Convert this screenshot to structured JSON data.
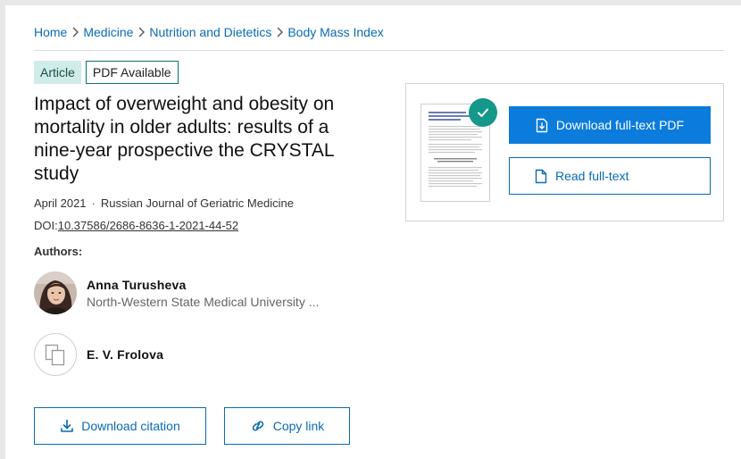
{
  "breadcrumb": {
    "items": [
      "Home",
      "Medicine",
      "Nutrition and Dietetics",
      "Body Mass Index"
    ]
  },
  "badges": {
    "type": "Article",
    "availability": "PDF Available"
  },
  "article": {
    "title": "Impact of overweight and obesity on mortality in older adults: results of a nine-year prospective the CRYSTAL study",
    "date": "April 2021",
    "separator": "·",
    "journal": "Russian Journal of Geriatric Medicine",
    "doi_prefix": "DOI:",
    "doi": "10.37586/2686-8636-1-2021-44-52"
  },
  "authors": {
    "label": "Authors:",
    "list": [
      {
        "name": "Anna Turusheva",
        "affiliation": "North-Western State Medical University ...",
        "avatar": "photo"
      },
      {
        "name": "E. V. Frolova",
        "affiliation": "",
        "avatar": "placeholder-icon"
      }
    ]
  },
  "actions": {
    "download_citation": "Download citation",
    "copy_link": "Copy link"
  },
  "side_panel": {
    "download_pdf": "Download full-text PDF",
    "read_fulltext": "Read full-text"
  },
  "colors": {
    "link": "#0a6bb5",
    "primary_button": "#0b7bdc",
    "badge_bg": "#d0ece9",
    "check_badge": "#13988a"
  }
}
